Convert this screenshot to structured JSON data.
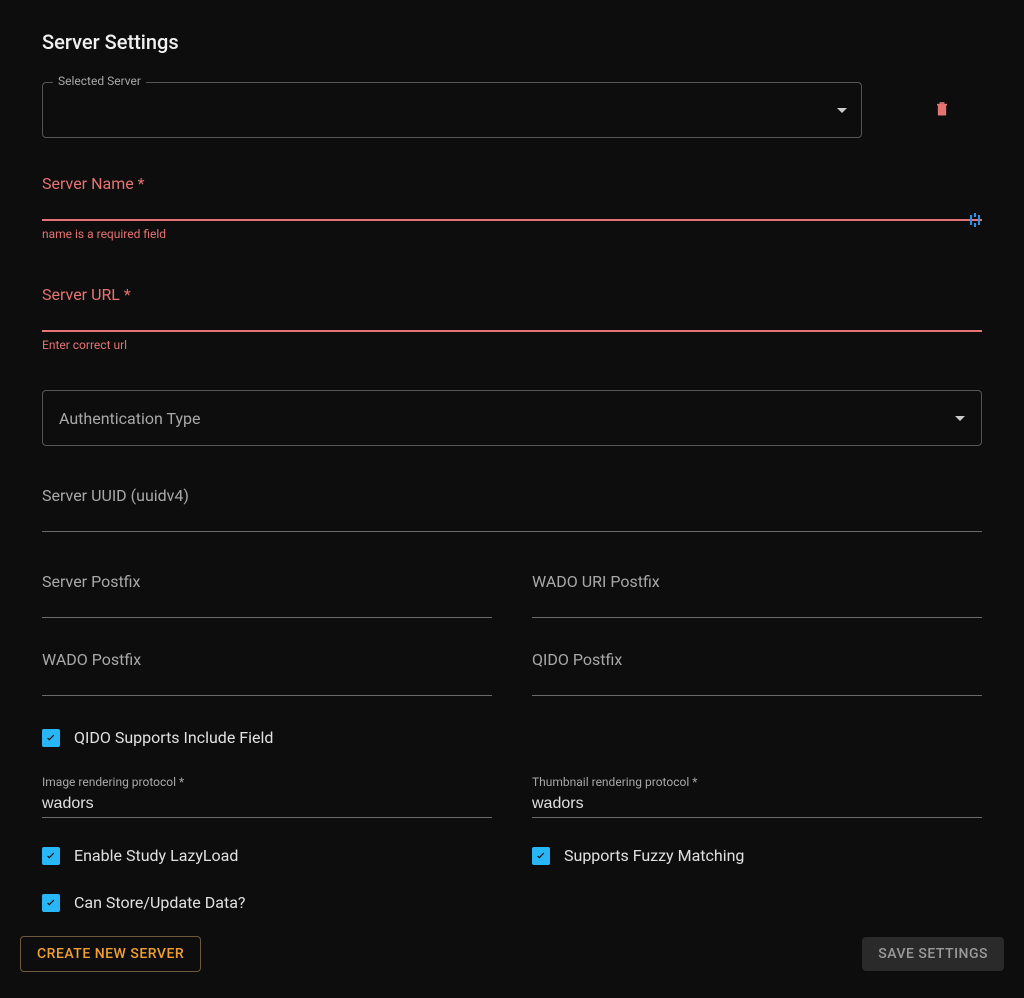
{
  "title": "Server Settings",
  "selected_server": {
    "label": "Selected Server",
    "value": ""
  },
  "icons": {
    "delete": "trash-icon",
    "edit_end": "text-cursor-icon"
  },
  "server_name": {
    "label": "Server Name *",
    "value": "",
    "error": "name is a required field"
  },
  "server_url": {
    "label": "Server URL *",
    "value": "",
    "error": "Enter correct url"
  },
  "auth_type": {
    "label": "Authentication Type",
    "value": ""
  },
  "server_uuid": {
    "label": "Server UUID (uuidv4)",
    "value": ""
  },
  "server_postfix": {
    "label": "Server Postfix",
    "value": ""
  },
  "wado_uri_postfix": {
    "label": "WADO URI Postfix",
    "value": ""
  },
  "wado_postfix": {
    "label": "WADO Postfix",
    "value": ""
  },
  "qido_postfix": {
    "label": "QIDO Postfix",
    "value": ""
  },
  "qido_include": {
    "label": "QIDO Supports Include Field",
    "checked": true
  },
  "image_protocol": {
    "label": "Image rendering protocol *",
    "value": "wadors"
  },
  "thumb_protocol": {
    "label": "Thumbnail rendering protocol *",
    "value": "wadors"
  },
  "enable_lazyload": {
    "label": "Enable Study LazyLoad",
    "checked": true
  },
  "fuzzy_matching": {
    "label": "Supports Fuzzy Matching",
    "checked": true
  },
  "can_store": {
    "label": "Can Store/Update Data?",
    "checked": true
  },
  "buttons": {
    "create": "Create New Server",
    "save": "Save Settings"
  },
  "colors": {
    "accent": "#29b6f6",
    "error": "#e57373",
    "warn": "#f0a030"
  }
}
